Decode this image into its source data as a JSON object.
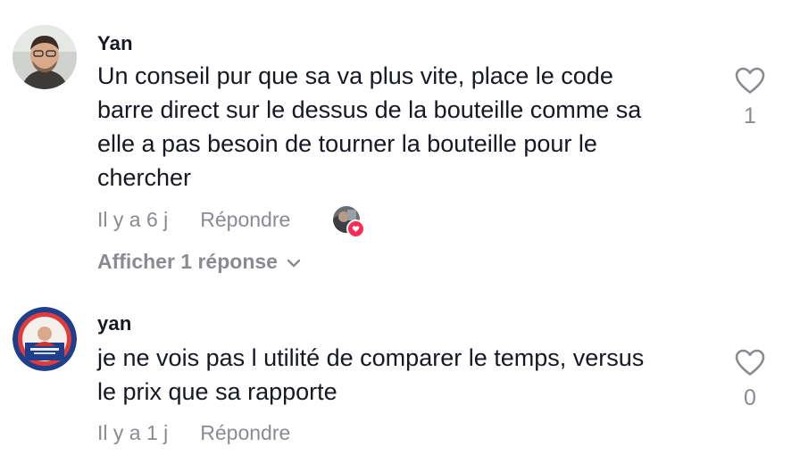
{
  "comments": [
    {
      "username": "Yan",
      "text_lines": [
        "Un conseil pur que sa va plus vite, place le code",
        "barre direct sur le dessus de la bouteille comme sa",
        "elle a pas besoin de tourner la bouteille pour le",
        "chercher"
      ],
      "time": "Il y a 6 j",
      "reply_label": "Répondre",
      "like_count": "1",
      "view_replies": "Afficher 1 réponse",
      "icons": {
        "like": "heart-outline-icon",
        "creator_liked": "creator-liked-badge",
        "expand": "chevron-down-icon"
      }
    },
    {
      "username": "yan",
      "text_lines": [
        "je ne vois pas l utilité de comparer le temps, versus",
        "le prix que sa rapporte"
      ],
      "time": "Il y a 1 j",
      "reply_label": "Répondre",
      "like_count": "0",
      "icons": {
        "like": "heart-outline-icon"
      }
    }
  ],
  "colors": {
    "text": "#161823",
    "muted": "#8a8b91",
    "heart_badge": "#fe2c55"
  }
}
